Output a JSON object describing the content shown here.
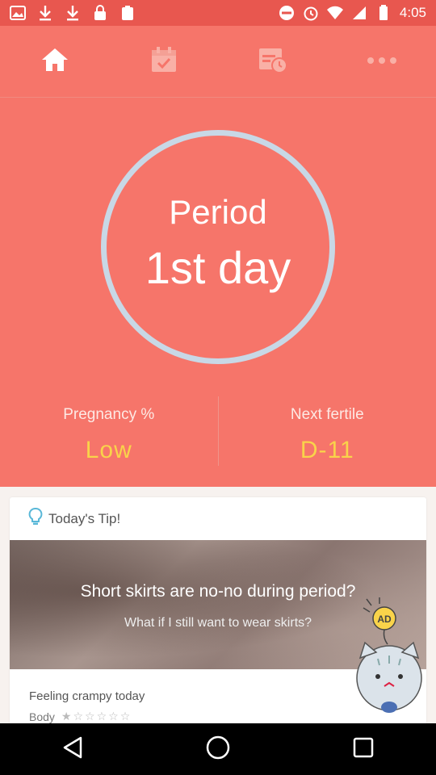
{
  "status_bar": {
    "time": "4:05"
  },
  "nav_tabs": [
    {
      "icon": "home-icon",
      "active": true
    },
    {
      "icon": "calendar-check-icon",
      "active": false
    },
    {
      "icon": "schedule-icon",
      "active": false
    },
    {
      "icon": "more-icon",
      "active": false
    }
  ],
  "cycle": {
    "line1": "Period",
    "line2": "1st day"
  },
  "stats": {
    "pregnancy": {
      "label": "Pregnancy %",
      "value": "Low"
    },
    "fertile": {
      "label": "Next fertile",
      "value": "D-11"
    }
  },
  "tip": {
    "header": "Today's Tip!",
    "title": "Short skirts are no-no during period?",
    "subtitle": "What if I still want to wear skirts?",
    "ad_label": "AD"
  },
  "feeling": {
    "title": "Feeling crampy today",
    "category": "Body",
    "rating": 1,
    "max_rating": 6
  },
  "colors": {
    "primary": "#f6756a",
    "accent": "#f9d34a",
    "ring": "#c8d8e6"
  }
}
